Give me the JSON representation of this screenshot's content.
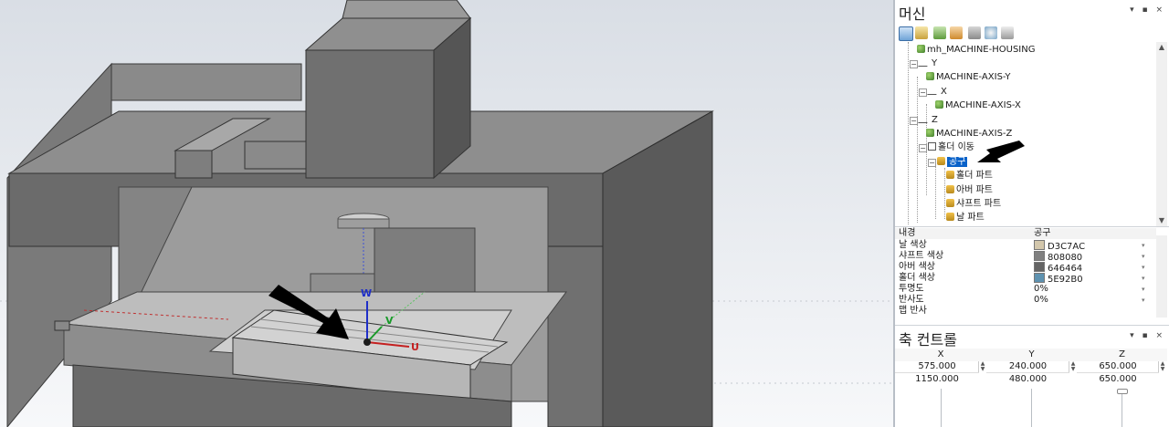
{
  "machine_panel": {
    "title": "머신",
    "controls": "▾ ▪ ×",
    "toolbar_icons": [
      "tree-view-icon",
      "add-axis-icon",
      "add-part-icon",
      "add-tool-icon",
      "move-icon",
      "rotate-icon",
      "settings-icon"
    ],
    "tree": [
      {
        "label": "mh_MACHINE-HOUSING",
        "kind": "part"
      },
      {
        "label": "Y",
        "kind": "axis"
      },
      {
        "label": "MACHINE-AXIS-Y",
        "kind": "part"
      },
      {
        "label": "X",
        "kind": "axis"
      },
      {
        "label": "MACHINE-AXIS-X",
        "kind": "part"
      },
      {
        "label": "Z",
        "kind": "axis"
      },
      {
        "label": "MACHINE-AXIS-Z",
        "kind": "part"
      },
      {
        "label": "홀더 이동",
        "kind": "group"
      },
      {
        "label": "공구",
        "kind": "tool",
        "selected": true
      },
      {
        "label": "홀더 파트",
        "kind": "toolpart"
      },
      {
        "label": "아버 파트",
        "kind": "toolpart"
      },
      {
        "label": "샤프트 파트",
        "kind": "toolpart"
      },
      {
        "label": "날 파트",
        "kind": "toolpart"
      }
    ]
  },
  "properties": {
    "header_name": "내경",
    "header_value": "공구",
    "rows": [
      {
        "name": "날 색상",
        "value": "D3C7AC",
        "color": "#D3C7AC"
      },
      {
        "name": "샤프트 색상",
        "value": "808080",
        "color": "#808080"
      },
      {
        "name": "아버 색상",
        "value": "646464",
        "color": "#646464"
      },
      {
        "name": "홀더 색상",
        "value": "5E92B0",
        "color": "#5E92B0"
      },
      {
        "name": "투명도",
        "value": "0%"
      },
      {
        "name": "반사도",
        "value": "0%"
      },
      {
        "name": "맵 반사",
        "value": ""
      }
    ]
  },
  "axis_control": {
    "title": "축 컨트롤",
    "controls": "▾ ▪ ×",
    "columns": [
      "X",
      "Y",
      "Z"
    ],
    "values": [
      "575.000",
      "240.000",
      "650.000"
    ],
    "limits": [
      "1150.000",
      "480.000",
      "650.000"
    ]
  },
  "viewport": {
    "triad": {
      "w": "W",
      "v": "V",
      "u": "U"
    },
    "colors": {
      "accent": "#0a62c9",
      "machine": "#6e6e6e",
      "dark": "#3f3f3f",
      "light": "#a2a2a2"
    }
  }
}
